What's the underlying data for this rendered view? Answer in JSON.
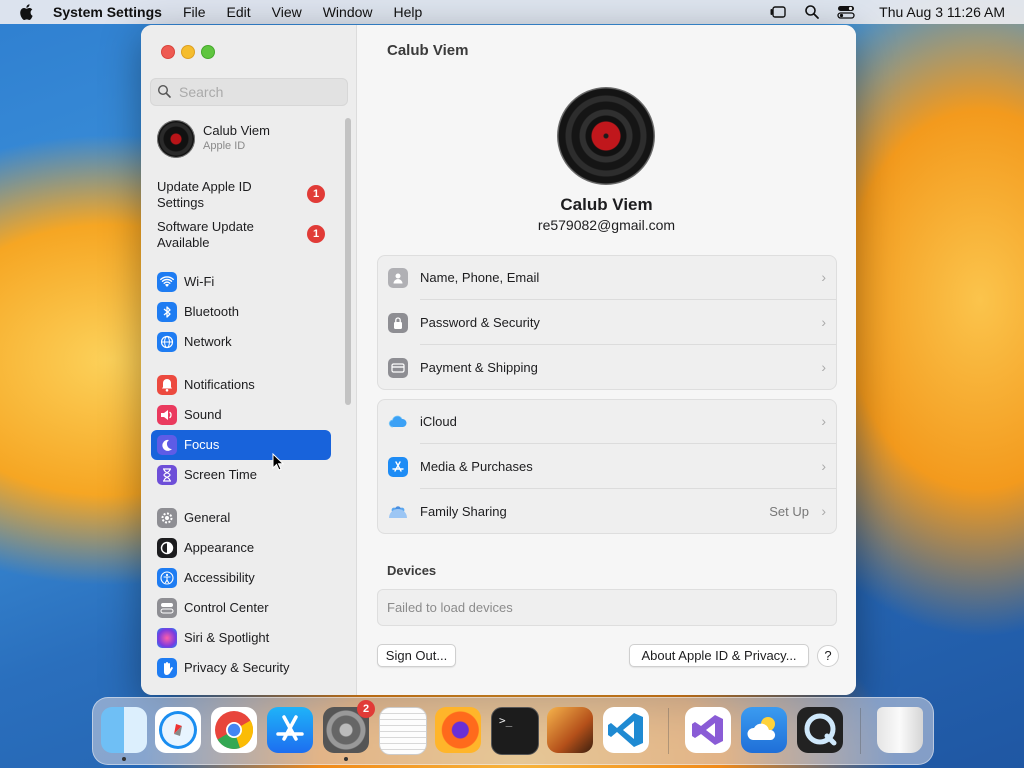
{
  "menubar": {
    "app": "System Settings",
    "items": [
      "File",
      "Edit",
      "View",
      "Window",
      "Help"
    ],
    "clock": "Thu Aug 3  11:26 AM"
  },
  "sidebar": {
    "search_placeholder": "Search",
    "account": {
      "name": "Calub Viem",
      "subtitle": "Apple ID"
    },
    "notices": [
      {
        "label": "Update Apple ID Settings",
        "badge": "1"
      },
      {
        "label": "Software Update Available",
        "badge": "1"
      }
    ],
    "items": [
      {
        "label": "Wi-Fi",
        "icon": "wifi-icon",
        "color": "#1e7cf2"
      },
      {
        "label": "Bluetooth",
        "icon": "bluetooth-icon",
        "color": "#1e7cf2"
      },
      {
        "label": "Network",
        "icon": "network-globe-icon",
        "color": "#1e7cf2"
      },
      {
        "label": "Notifications",
        "icon": "notifications-bell-icon",
        "color": "#ec4a3f"
      },
      {
        "label": "Sound",
        "icon": "sound-speaker-icon",
        "color": "#ea3a5e"
      },
      {
        "label": "Focus",
        "icon": "focus-moon-icon",
        "color": "#5e5ce6"
      },
      {
        "label": "Screen Time",
        "icon": "hourglass-icon",
        "color": "#6e4fd8"
      },
      {
        "label": "General",
        "icon": "gear-icon",
        "color": "#8e8e93"
      },
      {
        "label": "Appearance",
        "icon": "appearance-icon",
        "color": "#1c1c1e"
      },
      {
        "label": "Accessibility",
        "icon": "accessibility-icon",
        "color": "#1e7cf2"
      },
      {
        "label": "Control Center",
        "icon": "control-center-icon",
        "color": "#8e8e93"
      },
      {
        "label": "Siri & Spotlight",
        "icon": "siri-icon",
        "color": "#b04ad8"
      },
      {
        "label": "Privacy & Security",
        "icon": "privacy-hand-icon",
        "color": "#1e7cf2"
      }
    ],
    "selected": "Focus"
  },
  "main": {
    "title": "Calub Viem",
    "profile": {
      "name": "Calub Viem",
      "email": "re579082@gmail.com"
    },
    "group1": [
      {
        "label": "Name, Phone, Email",
        "icon": "person-icon"
      },
      {
        "label": "Password & Security",
        "icon": "lock-icon"
      },
      {
        "label": "Payment & Shipping",
        "icon": "credit-card-icon"
      }
    ],
    "group2": [
      {
        "label": "iCloud",
        "icon": "icloud-icon"
      },
      {
        "label": "Media & Purchases",
        "icon": "app-store-icon"
      },
      {
        "label": "Family Sharing",
        "icon": "family-sharing-icon",
        "extra": "Set Up"
      }
    ],
    "devices_heading": "Devices",
    "devices_message": "Failed to load devices",
    "sign_out": "Sign Out...",
    "about": "About Apple ID & Privacy...",
    "help": "?"
  },
  "dock": {
    "apps": [
      "Finder",
      "Safari",
      "Google Chrome",
      "App Store",
      "System Settings",
      "TextEdit",
      "Firefox",
      "Terminal",
      "GarageBand",
      "Visual Studio Code",
      "Visual Studio",
      "Weather",
      "QuickTime Player",
      "Trash"
    ],
    "settings_badge": "2"
  }
}
